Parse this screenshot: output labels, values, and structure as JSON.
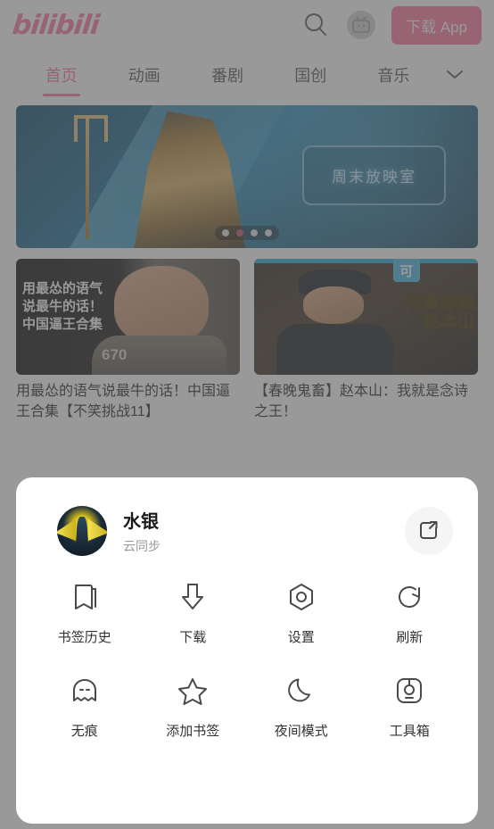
{
  "header": {
    "logo_text": "bilibili",
    "search_icon": "search-icon",
    "mascot_icon": "bilibili-tv-mascot-icon",
    "download_label": "下载 App"
  },
  "tabs": {
    "items": [
      {
        "label": "首页",
        "active": true
      },
      {
        "label": "动画",
        "active": false
      },
      {
        "label": "番剧",
        "active": false
      },
      {
        "label": "国创",
        "active": false
      },
      {
        "label": "音乐",
        "active": false
      }
    ],
    "more_icon": "chevron-down-icon"
  },
  "banner": {
    "plate_text": "周末放映室",
    "dots": 4,
    "active_dot": 2
  },
  "cards": [
    {
      "overlay_text": "用最怂的语气\n说最牛的话！\n中国逼王合集",
      "overlay_number": "670",
      "title": "用最怂的语气说最牛的话！中国逼王合集【不笑挑战11】"
    },
    {
      "badge": "可",
      "overlay_text": "鬼畜春晚\n赵本山",
      "title": "【春晚鬼畜】赵本山：我就是念诗之王！"
    }
  ],
  "sheet": {
    "profile": {
      "name": "水银",
      "subtitle": "云同步",
      "avatar_icon": "user-avatar",
      "share_icon": "external-link-icon"
    },
    "actions": [
      {
        "label": "书签历史",
        "icon": "bookmark-icon"
      },
      {
        "label": "下载",
        "icon": "download-arrow-icon"
      },
      {
        "label": "设置",
        "icon": "settings-hexagon-icon"
      },
      {
        "label": "刷新",
        "icon": "refresh-icon"
      },
      {
        "label": "无痕",
        "icon": "incognito-ghost-icon"
      },
      {
        "label": "添加书签",
        "icon": "star-icon"
      },
      {
        "label": "夜间模式",
        "icon": "moon-icon"
      },
      {
        "label": "工具箱",
        "icon": "toolbox-icon"
      }
    ]
  },
  "colors": {
    "brand_pink": "#fb7299",
    "overlay": "rgba(90,90,90,.62)",
    "sheet_bg": "#ffffff"
  }
}
